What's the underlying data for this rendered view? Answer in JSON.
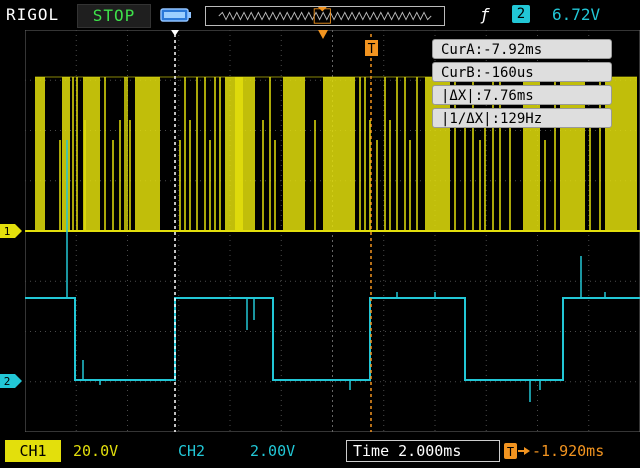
{
  "header": {
    "brand": "RIGOL",
    "run_state": "STOP",
    "trigger_source": "2",
    "trigger_level": "6.72V"
  },
  "cursors": {
    "cur_a": "CurA:-7.92ms",
    "cur_b": "CurB:-160us",
    "delta_x": "|ΔX|:7.76ms",
    "inv_delta_x": "|1/ΔX|:129Hz"
  },
  "channels": {
    "ch1_marker": "1",
    "ch2_marker": "2",
    "trigger_marker": "T"
  },
  "footer": {
    "ch1_label": "CH1",
    "ch1_scale": "20.0V",
    "ch2_label": "CH2",
    "ch2_scale": "2.00V",
    "timebase": "Time 2.000ms",
    "trigger_offset": "-1.920ms"
  },
  "colors": {
    "ch1": "#e3df0c",
    "ch2": "#22c7d6",
    "trigger": "#f29420",
    "run_state": "#3ee14a"
  }
}
